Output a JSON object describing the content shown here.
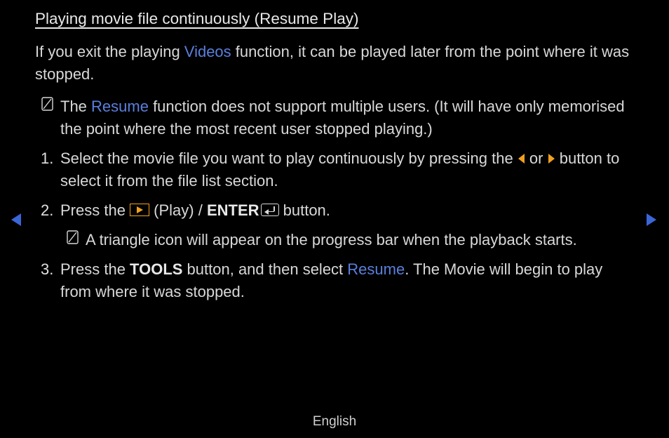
{
  "title": "Playing movie file continuously (Resume Play)",
  "intro": {
    "pre": "If you exit the playing ",
    "videos": "Videos",
    "post": " function, it can be played later from the point where it was stopped."
  },
  "note": {
    "pre": "The ",
    "resume": "Resume",
    "post": " function does not support multiple users. (It will have only memorised the point where the most recent user stopped playing.)"
  },
  "steps": {
    "s1": {
      "num": "1.",
      "a": "Select the movie file you want to play continuously by pressing the ",
      "b": " or ",
      "c": " button to select it from the file list section."
    },
    "s2": {
      "num": "2.",
      "a": "Press the ",
      "play": " (Play) / ",
      "enter": "ENTER",
      "tail": " button."
    },
    "s2note": " A triangle icon will appear on the progress bar when the playback starts.",
    "s3": {
      "num": "3.",
      "a": "Press the ",
      "tools": "TOOLS",
      "b": " button, and then select ",
      "resume": "Resume",
      "c": ". The Movie will begin to play from where it was stopped."
    }
  },
  "language": "English"
}
